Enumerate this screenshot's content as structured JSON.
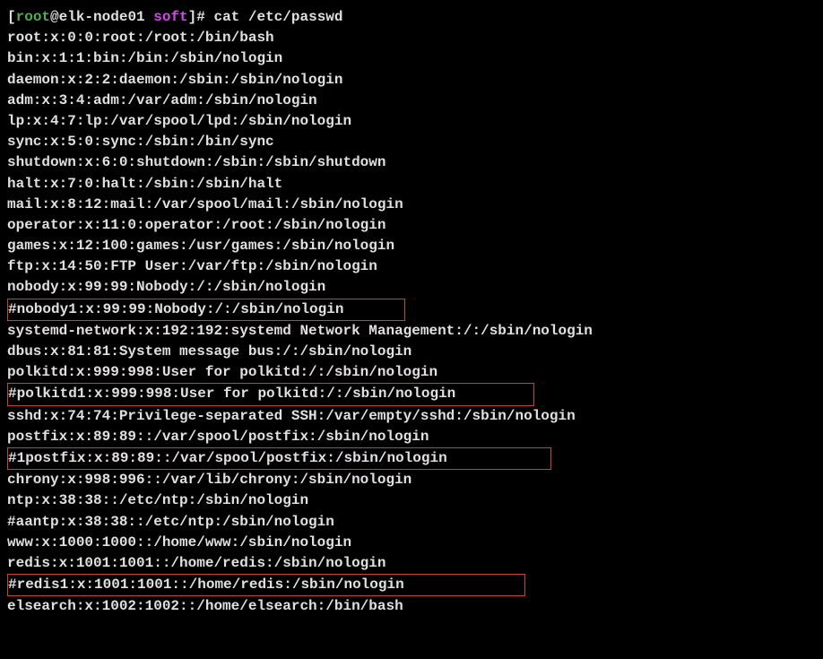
{
  "prompt": {
    "bracket_open": "[",
    "user": "root",
    "at": "@",
    "host": "elk-node01",
    "cwd": "soft",
    "bracket_close": "]",
    "prompt_char": "# ",
    "command": "cat /etc/passwd"
  },
  "lines": [
    {
      "text": "root:x:0:0:root:/root:/bin/bash",
      "highlighted": false
    },
    {
      "text": "bin:x:1:1:bin:/bin:/sbin/nologin",
      "highlighted": false
    },
    {
      "text": "daemon:x:2:2:daemon:/sbin:/sbin/nologin",
      "highlighted": false
    },
    {
      "text": "adm:x:3:4:adm:/var/adm:/sbin/nologin",
      "highlighted": false
    },
    {
      "text": "lp:x:4:7:lp:/var/spool/lpd:/sbin/nologin",
      "highlighted": false
    },
    {
      "text": "sync:x:5:0:sync:/sbin:/bin/sync",
      "highlighted": false
    },
    {
      "text": "shutdown:x:6:0:shutdown:/sbin:/sbin/shutdown",
      "highlighted": false
    },
    {
      "text": "halt:x:7:0:halt:/sbin:/sbin/halt",
      "highlighted": false
    },
    {
      "text": "mail:x:8:12:mail:/var/spool/mail:/sbin/nologin",
      "highlighted": false
    },
    {
      "text": "operator:x:11:0:operator:/root:/sbin/nologin",
      "highlighted": false
    },
    {
      "text": "games:x:12:100:games:/usr/games:/sbin/nologin",
      "highlighted": false
    },
    {
      "text": "ftp:x:14:50:FTP User:/var/ftp:/sbin/nologin",
      "highlighted": false
    },
    {
      "text": "nobody:x:99:99:Nobody:/:/sbin/nologin",
      "highlighted": false
    },
    {
      "text": "#nobody1:x:99:99:Nobody:/:/sbin/nologin       ",
      "highlighted": true
    },
    {
      "text": "systemd-network:x:192:192:systemd Network Management:/:/sbin/nologin",
      "highlighted": false
    },
    {
      "text": "dbus:x:81:81:System message bus:/:/sbin/nologin",
      "highlighted": false
    },
    {
      "text": "polkitd:x:999:998:User for polkitd:/:/sbin/nologin",
      "highlighted": false
    },
    {
      "text": "#polkitd1:x:999:998:User for polkitd:/:/sbin/nologin         ",
      "highlighted": true
    },
    {
      "text": "sshd:x:74:74:Privilege-separated SSH:/var/empty/sshd:/sbin/nologin",
      "highlighted": false
    },
    {
      "text": "postfix:x:89:89::/var/spool/postfix:/sbin/nologin",
      "highlighted": false
    },
    {
      "text": "#1postfix:x:89:89::/var/spool/postfix:/sbin/nologin            ",
      "highlighted": true
    },
    {
      "text": "chrony:x:998:996::/var/lib/chrony:/sbin/nologin",
      "highlighted": false
    },
    {
      "text": "ntp:x:38:38::/etc/ntp:/sbin/nologin",
      "highlighted": false
    },
    {
      "text": "#aantp:x:38:38::/etc/ntp:/sbin/nologin",
      "highlighted": false
    },
    {
      "text": "www:x:1000:1000::/home/www:/sbin/nologin",
      "highlighted": false
    },
    {
      "text": "redis:x:1001:1001::/home/redis:/sbin/nologin",
      "highlighted": false
    },
    {
      "text": "#redis1:x:1001:1001::/home/redis:/sbin/nologin              ",
      "highlighted": true
    },
    {
      "text": "elsearch:x:1002:1002::/home/elsearch:/bin/bash",
      "highlighted": false
    }
  ]
}
